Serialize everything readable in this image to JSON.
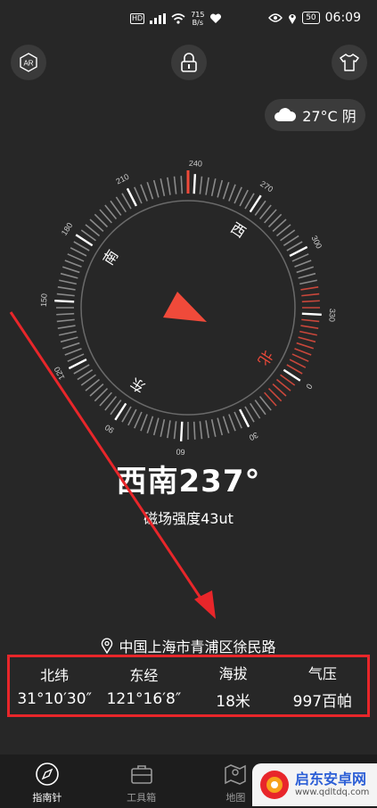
{
  "status_bar": {
    "hd": "HD",
    "speed_value": "715",
    "speed_unit": "B/s",
    "battery": "50",
    "time": "06:09"
  },
  "weather": {
    "label": "27°C 阴",
    "icon": "cloud-icon"
  },
  "compass": {
    "ticks": [
      "240",
      "270",
      "300",
      "330",
      "0",
      "30",
      "60",
      "90",
      "120",
      "150",
      "180",
      "210"
    ],
    "directions": {
      "west": "西",
      "north": "北",
      "east": "东",
      "south": "南"
    }
  },
  "heading": "西南237°",
  "magnetic": "磁场强度43ut",
  "location": "中国上海市青浦区徐民路",
  "info": [
    {
      "label": "北纬",
      "value": "31°10′30″"
    },
    {
      "label": "东经",
      "value": "121°16′8″"
    },
    {
      "label": "海拔",
      "value": "18米"
    },
    {
      "label": "气压",
      "value": "997百帕"
    }
  ],
  "tabs": [
    {
      "label": "指南针",
      "icon": "compass-icon",
      "active": true
    },
    {
      "label": "工具箱",
      "icon": "toolbox-icon",
      "active": false
    },
    {
      "label": "地图",
      "icon": "map-icon",
      "active": false
    }
  ],
  "watermark": {
    "name": "启东安卓网",
    "url": "www.qdltdq.com"
  },
  "colors": {
    "accent": "#f04a3a",
    "highlight_box": "#e8262a",
    "background": "#272727"
  }
}
